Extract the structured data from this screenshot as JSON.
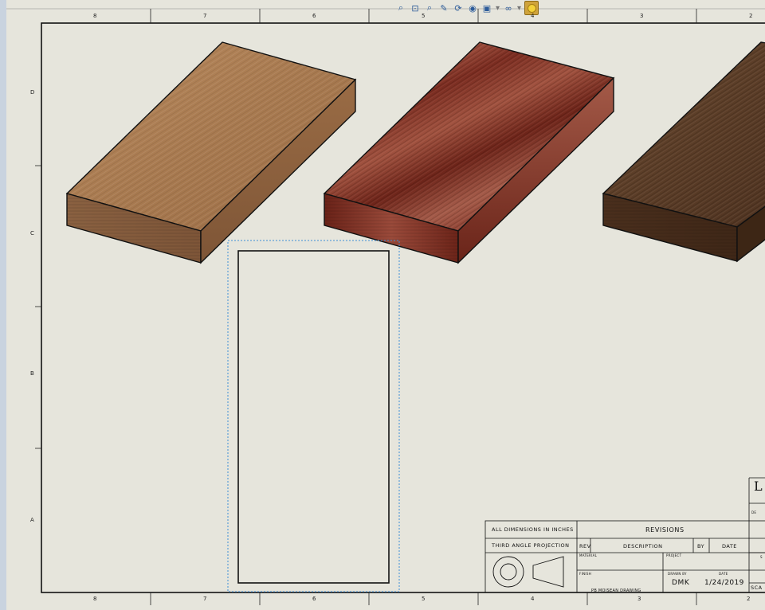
{
  "toolbar": {
    "icons": [
      "zoom-to-fit-icon",
      "zoom-area-icon",
      "zoom-in-out-icon",
      "view-orientation-icon",
      "rotate-view-icon",
      "hide-show-icon",
      "display-style-icon",
      "appearance-icon",
      "shaded-view-icon"
    ],
    "dropdown_glyph": "▾"
  },
  "sheet": {
    "zone_columns_top": [
      "8",
      "7",
      "6",
      "5",
      "4",
      "3",
      "2"
    ],
    "zone_columns_bottom": [
      "8",
      "7",
      "6",
      "5",
      "4",
      "3",
      "2"
    ],
    "zone_rows": [
      "D",
      "C",
      "B",
      "A"
    ]
  },
  "title_block": {
    "all_dimensions": "ALL DIMENSIONS IN INCHES",
    "projection": "THIRD ANGLE PROJECTION",
    "revisions": "REVISIONS",
    "rev": "REV",
    "description": "DESCRIPTION",
    "by": "BY",
    "date": "DATE",
    "material_label": "MATERIAL",
    "project_label": "PROJECT",
    "finish_label": "FINISH",
    "drawn_by_label": "DRAWN BY",
    "date_label": "DATE",
    "drawn_by": "DMK",
    "drawn_date": "1/24/2019",
    "drawing_name": "PB MOISEAN DRAWING",
    "title_partial": "L",
    "scale_partial": "SCA",
    "sheet_size_partial": "S",
    "description_partial": "DE"
  },
  "colors": {
    "sheet_background": "#e6e5dc",
    "light_wood": "#a9774e",
    "red_wood": "#7a2e22",
    "dark_wood": "#5a3a24",
    "selection_dashed": "#3f8fd6"
  }
}
